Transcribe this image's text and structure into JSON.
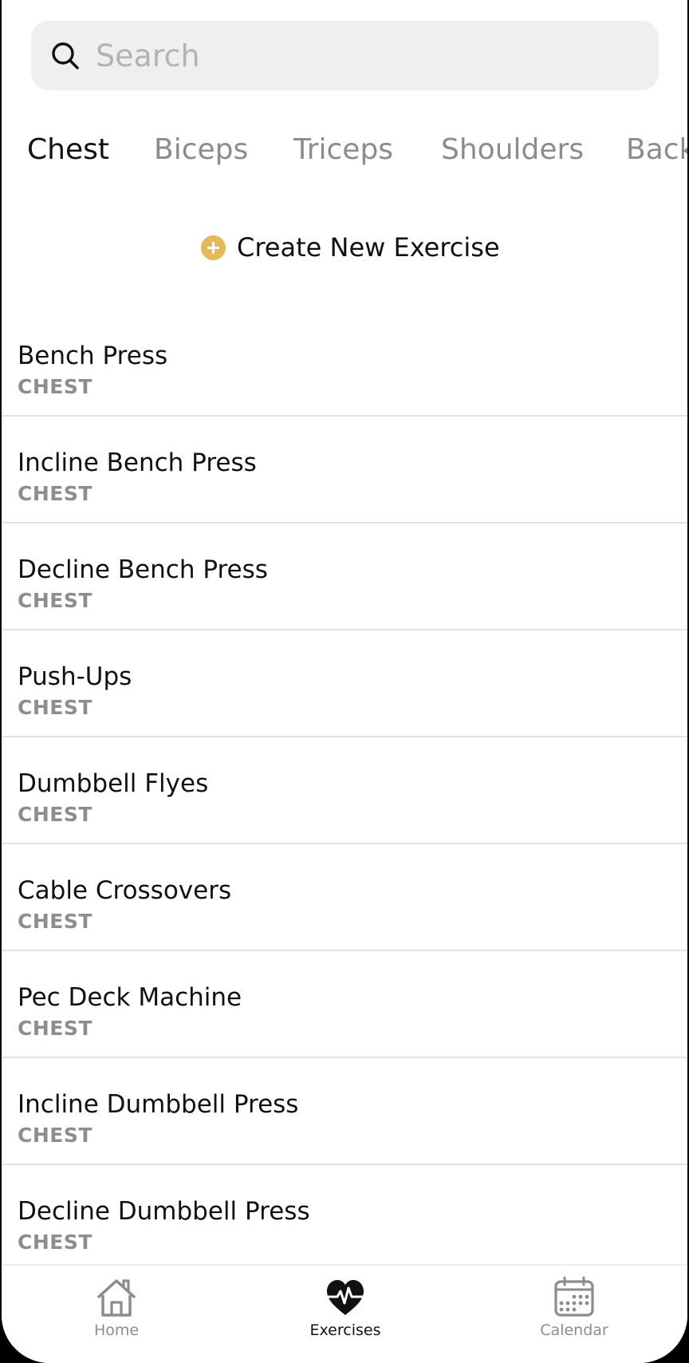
{
  "search": {
    "placeholder": "Search",
    "value": ""
  },
  "tabs": [
    {
      "label": "Chest",
      "active": true
    },
    {
      "label": "Biceps",
      "active": false
    },
    {
      "label": "Triceps",
      "active": false
    },
    {
      "label": "Shoulders",
      "active": false
    },
    {
      "label": "Back",
      "active": false
    }
  ],
  "create_button": {
    "label": "Create New Exercise",
    "icon": "plus-circle-icon",
    "accent_color": "#e3b95a"
  },
  "exercises": [
    {
      "name": "Bench Press",
      "category": "CHEST"
    },
    {
      "name": "Incline Bench Press",
      "category": "CHEST"
    },
    {
      "name": "Decline Bench Press",
      "category": "CHEST"
    },
    {
      "name": "Push-Ups",
      "category": "CHEST"
    },
    {
      "name": "Dumbbell Flyes",
      "category": "CHEST"
    },
    {
      "name": "Cable Crossovers",
      "category": "CHEST"
    },
    {
      "name": "Pec Deck Machine",
      "category": "CHEST"
    },
    {
      "name": "Incline Dumbbell Press",
      "category": "CHEST"
    },
    {
      "name": "Decline Dumbbell Press",
      "category": "CHEST"
    }
  ],
  "nav": [
    {
      "label": "Home",
      "icon": "home-icon",
      "active": false
    },
    {
      "label": "Exercises",
      "icon": "heart-pulse-icon",
      "active": true
    },
    {
      "label": "Calendar",
      "icon": "calendar-icon",
      "active": false
    }
  ]
}
